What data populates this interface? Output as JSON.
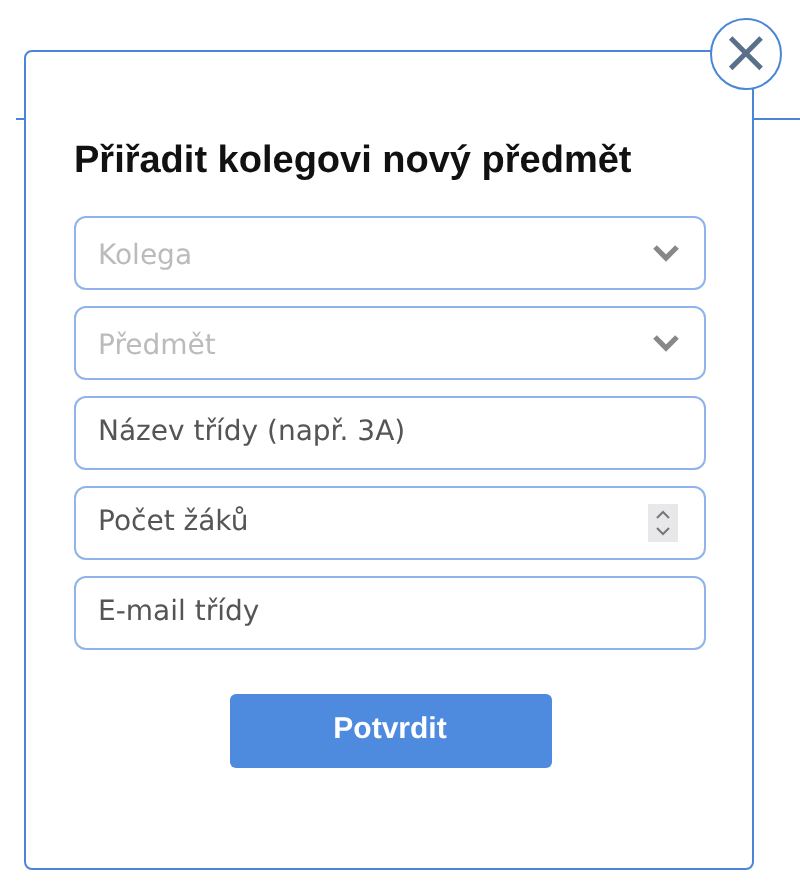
{
  "dialog": {
    "title": "Přiřadit kolegovi nový předmět",
    "close_label": "×",
    "fields": [
      {
        "kind": "select",
        "placeholder": "Kolega"
      },
      {
        "kind": "select",
        "placeholder": "Předmět"
      },
      {
        "kind": "text",
        "placeholder": "Název třídy (např. 3A)"
      },
      {
        "kind": "number",
        "placeholder": "Počet žáků"
      },
      {
        "kind": "email",
        "placeholder": "E-mail třídy"
      }
    ],
    "submit": "Potvrdit"
  }
}
